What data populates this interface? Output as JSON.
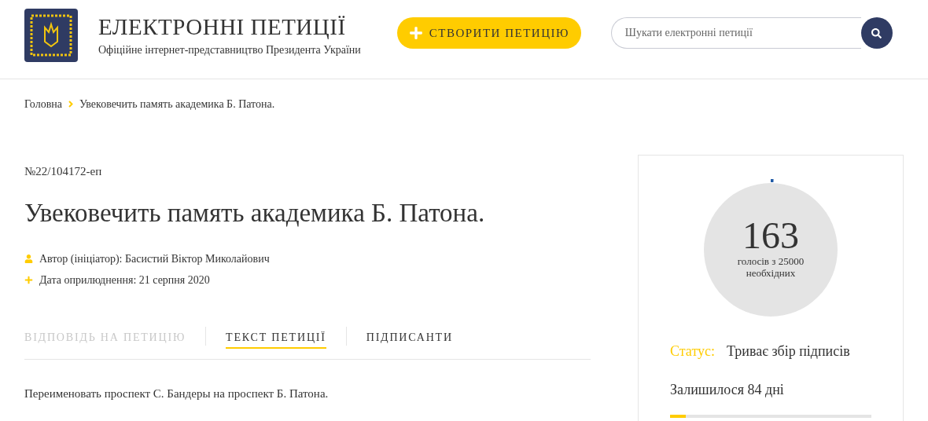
{
  "header": {
    "title": "ЕЛЕКТРОННІ ПЕТИЦІЇ",
    "subtitle": "Офіційне інтернет-представництво Президента України",
    "create_button": {
      "label": "СТВОРИТИ ПЕТИЦІЮ"
    },
    "search": {
      "placeholder": "Шукати електронні петиції"
    }
  },
  "breadcrumbs": [
    {
      "label": "Головна"
    },
    {
      "label": "Увековечить память академика Б. Патона."
    }
  ],
  "petition": {
    "number": "№22/104172-еп",
    "title": "Увековечить память академика Б. Патона.",
    "meta": [
      {
        "kind": "author",
        "text": "Автор (ініціатор): Басистий Віктор Миколайович"
      },
      {
        "kind": "date",
        "text": "Дата оприлюднення: 21 серпня 2020"
      }
    ],
    "tabs": [
      {
        "label": "ВІДПОВІДЬ НА ПЕТИЦІЮ",
        "selected": false,
        "disabled": true
      },
      {
        "label": "ТЕКСТ ПЕТИЦІЇ",
        "selected": true,
        "disabled": false
      },
      {
        "label": "ПІДПИСАНТИ",
        "selected": false,
        "disabled": false
      }
    ],
    "text": "Переименовать проспект С. Бандеры на проспект Б. Патона."
  },
  "votes": {
    "count": "163",
    "caption_1": "голосів з 25000",
    "caption_2": "необхідних",
    "level": 0.0065,
    "status_label": "Статус:",
    "status": "Триває збір підписів",
    "remaining": "Залишилося 84 дні",
    "time_bar": {
      "level": 0.08
    }
  }
}
